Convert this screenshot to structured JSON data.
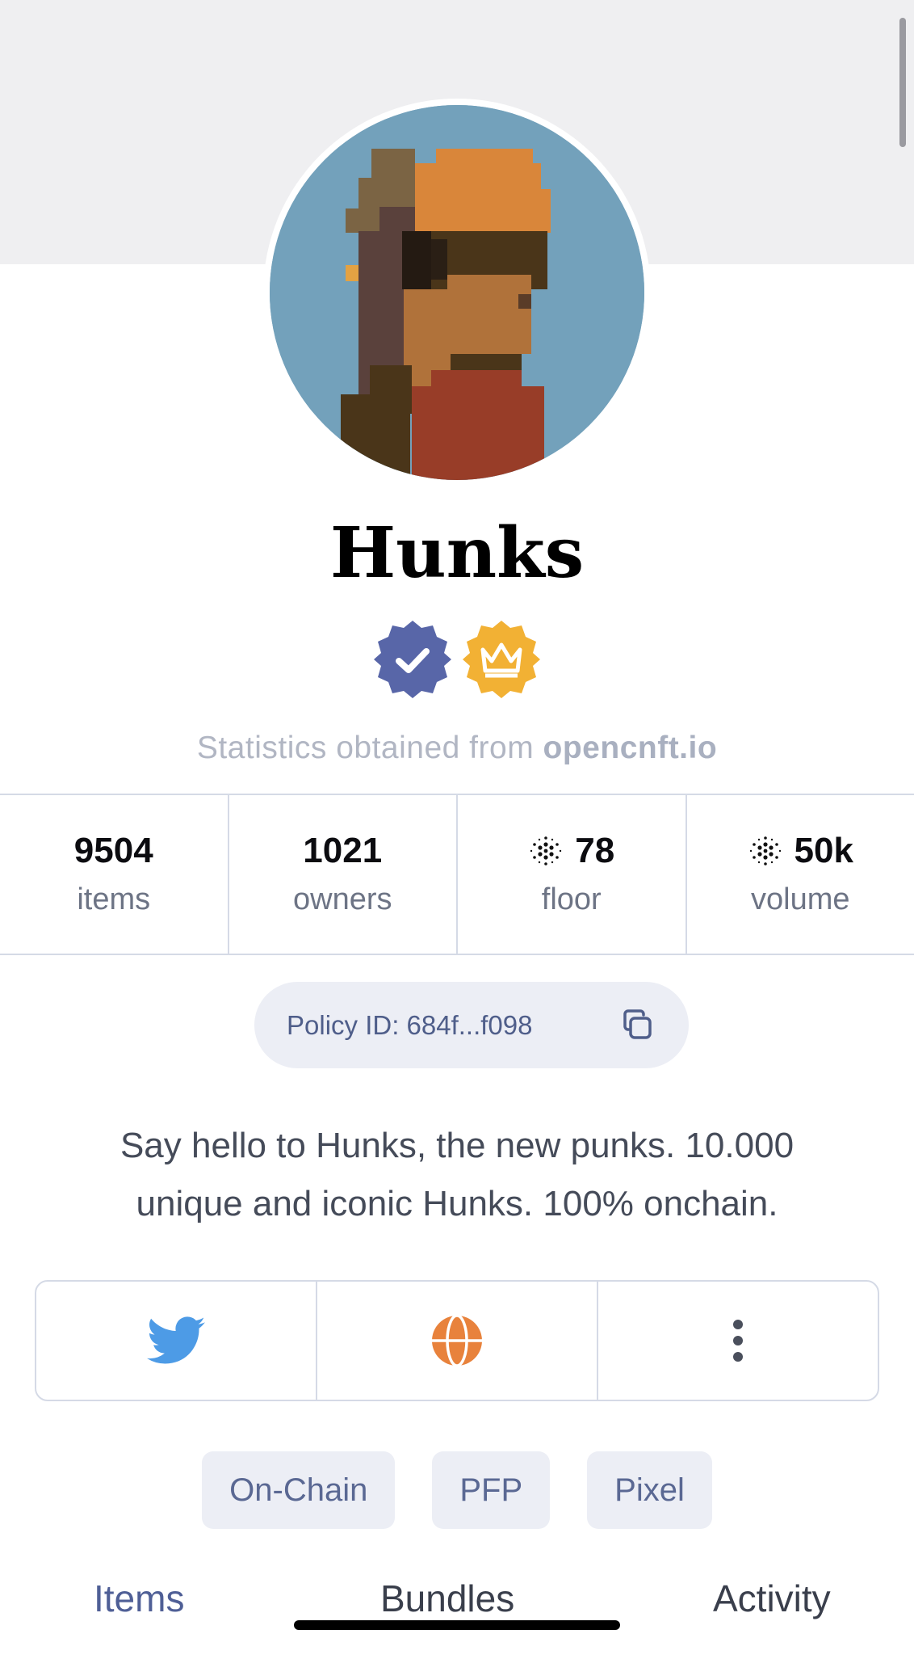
{
  "collection": {
    "name": "Hunks",
    "avatar_icon": "hunk-pixel-avatar"
  },
  "badges": [
    {
      "name": "verified-badge-icon",
      "color": "#5866a8"
    },
    {
      "name": "crown-badge-icon",
      "color": "#f2b134"
    }
  ],
  "stats_note": {
    "prefix": "Statistics obtained from",
    "source": "opencnft.io"
  },
  "stats": [
    {
      "value": "9504",
      "label": "items"
    },
    {
      "value": "1021",
      "label": "owners"
    },
    {
      "value": "78",
      "label": "floor",
      "currency_icon": "cardano-ada-icon"
    },
    {
      "value": "50k",
      "label": "volume",
      "currency_icon": "cardano-ada-icon"
    }
  ],
  "policy": {
    "text": "Policy ID: 684f...f098",
    "icon": "copy-icon"
  },
  "description": "Say hello to Hunks, the new punks. 10.000 unique and iconic Hunks. 100% onchain.",
  "links": [
    {
      "icon": "twitter-icon",
      "color": "#4d9be6"
    },
    {
      "icon": "globe-icon",
      "color": "#e8823c"
    },
    {
      "icon": "more-vertical-icon",
      "color": "#4a4f5c"
    }
  ],
  "tags": [
    "On-Chain",
    "PFP",
    "Pixel"
  ],
  "tabs": [
    {
      "label": "Items",
      "active": true
    },
    {
      "label": "Bundles",
      "active": false
    },
    {
      "label": "Activity",
      "active": false
    }
  ],
  "colors": {
    "accent": "#4f5f96",
    "border": "#d5dae6",
    "chip_bg": "#eceef5"
  }
}
